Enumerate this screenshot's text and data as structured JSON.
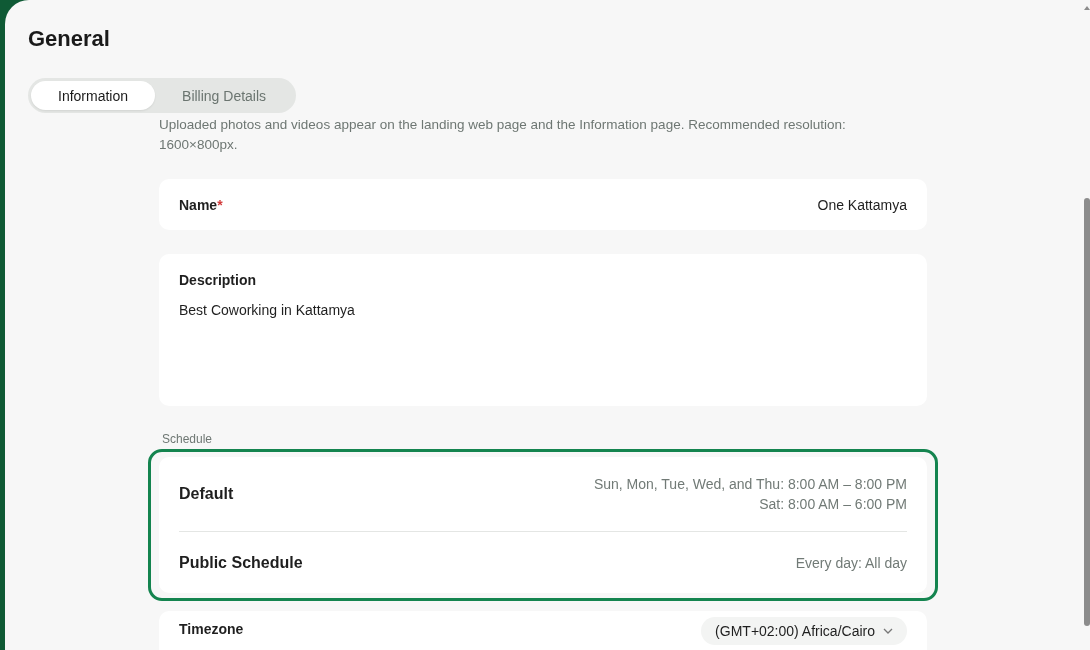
{
  "page": {
    "title": "General"
  },
  "tabs": [
    {
      "label": "Information",
      "selected": true
    },
    {
      "label": "Billing Details",
      "selected": false
    }
  ],
  "media_hint": "Uploaded photos and videos appear on the landing web page and the Information page. Recommended resolution: 1600×800px.",
  "name_field": {
    "label": "Name",
    "required_mark": "*",
    "value": "One Kattamya"
  },
  "description_field": {
    "label": "Description",
    "value": "Best Coworking in Kattamya"
  },
  "schedule": {
    "label": "Schedule",
    "highlighted": true,
    "rows": [
      {
        "title": "Default",
        "lines": [
          "Sun, Mon, Tue, Wed, and Thu: 8:00 AM – 8:00 PM",
          "Sat: 8:00 AM – 6:00 PM"
        ]
      },
      {
        "title": "Public Schedule",
        "lines": [
          "Every day: All day"
        ]
      }
    ]
  },
  "timezone": {
    "label": "Timezone",
    "value": "(GMT+02:00) Africa/Cairo"
  }
}
